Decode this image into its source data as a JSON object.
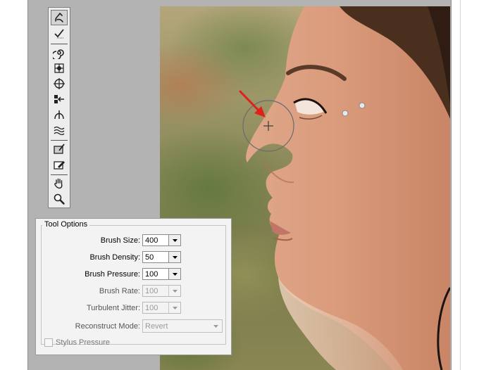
{
  "toolbar": {
    "tools": [
      {
        "name": "forward-warp-tool",
        "icon": "forward-warp-icon",
        "selected": true
      },
      {
        "name": "reconstruct-tool",
        "icon": "reconstruct-brush-icon"
      },
      {
        "name": "twirl-clockwise-tool",
        "icon": "twirl-icon"
      },
      {
        "name": "pucker-tool",
        "icon": "pucker-icon"
      },
      {
        "name": "bloat-tool",
        "icon": "bloat-icon"
      },
      {
        "name": "push-left-tool",
        "icon": "push-left-icon"
      },
      {
        "name": "mirror-tool",
        "icon": "mirror-icon"
      },
      {
        "name": "turbulence-tool",
        "icon": "turbulence-icon"
      },
      {
        "name": "freeze-mask-tool",
        "icon": "freeze-mask-icon"
      },
      {
        "name": "thaw-mask-tool",
        "icon": "thaw-mask-icon"
      },
      {
        "name": "hand-tool",
        "icon": "hand-icon"
      },
      {
        "name": "zoom-tool",
        "icon": "magnifier-icon"
      }
    ]
  },
  "tool_options": {
    "title": "Tool Options",
    "brush_size": {
      "label": "Brush Size:",
      "value": "400"
    },
    "brush_density": {
      "label": "Brush Density:",
      "value": "50"
    },
    "brush_pressure": {
      "label": "Brush Pressure:",
      "value": "100"
    },
    "brush_rate": {
      "label": "Brush Rate:",
      "value": "100"
    },
    "turbulent_jitter": {
      "label": "Turbulent Jitter:",
      "value": "100"
    },
    "reconstruct_mode": {
      "label": "Reconstruct Mode:",
      "value": "Revert"
    },
    "stylus_pressure": {
      "label": "Stylus Pressure",
      "checked": false
    }
  },
  "canvas": {
    "image": "profile-portrait-photo",
    "annotation_color": "#e0201b",
    "brush_cursor": "circle-crosshair"
  }
}
